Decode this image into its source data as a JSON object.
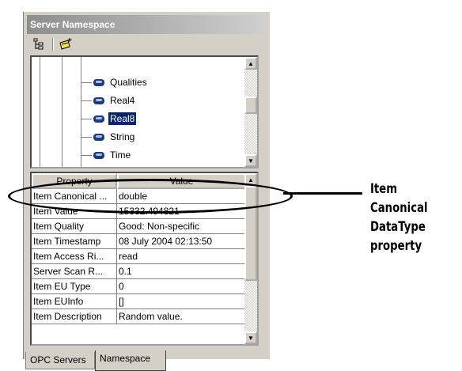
{
  "window": {
    "title": "Server Namespace"
  },
  "toolbar": {
    "tree_icon": "tree-view-icon",
    "add_icon": "add-group-icon"
  },
  "tree": {
    "items": [
      {
        "label": "Qualities",
        "selected": false
      },
      {
        "label": "Real4",
        "selected": false
      },
      {
        "label": "Real8",
        "selected": true
      },
      {
        "label": "String",
        "selected": false
      },
      {
        "label": "Time",
        "selected": false
      }
    ]
  },
  "table": {
    "columns": [
      "Property",
      "Value"
    ],
    "rows": [
      {
        "property": "Item Canonical ...",
        "value": "double"
      },
      {
        "property": "Item Value",
        "value": "15332.494821"
      },
      {
        "property": "Item Quality",
        "value": "Good: Non-specific"
      },
      {
        "property": "Item Timestamp",
        "value": "08 July 2004 02:13:50"
      },
      {
        "property": "Item Access Ri...",
        "value": "read"
      },
      {
        "property": "Server Scan R...",
        "value": "0.1"
      },
      {
        "property": "Item EU Type",
        "value": "0"
      },
      {
        "property": "Item EUInfo",
        "value": "[]"
      },
      {
        "property": "Item Description",
        "value": "Random value."
      }
    ]
  },
  "tabs": [
    {
      "label": "OPC Servers",
      "active": false
    },
    {
      "label": "Namespace",
      "active": true
    }
  ],
  "annotation": {
    "line1": "Item Canonical",
    "line2": "DataType",
    "line3": "property"
  },
  "colors": {
    "selection": "#0a246a",
    "titlebar": "#8e8e8e",
    "panel": "#d4d0c8"
  }
}
